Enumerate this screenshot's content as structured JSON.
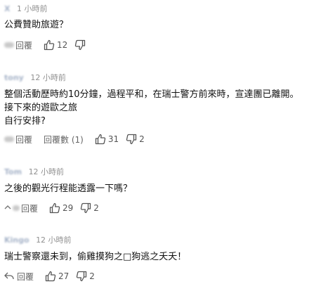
{
  "comments": [
    {
      "author": "X",
      "time": "1 小時前",
      "lines": [
        "公費贊助旅遊？"
      ],
      "reply_label": "回覆",
      "view_replies": "",
      "likes": "12",
      "dislikes": ""
    },
    {
      "author": "tony",
      "time": "12 小時前",
      "lines": [
        "整個活動歷時約10分鐘，過程平和，在瑞士警方前來時，宣達團已離開。",
        "接下來的遊歐之旅",
        "自行安排?"
      ],
      "reply_label": "回覆",
      "view_replies": "回覆數 (1)",
      "likes": "31",
      "dislikes": "2"
    },
    {
      "author": "Tom",
      "time": "12 小時前",
      "lines": [
        "之後的觀光行程能透露一下嗎？"
      ],
      "reply_label": "回覆",
      "view_replies": "",
      "likes": "29",
      "dislikes": "2"
    },
    {
      "author": "Kingo",
      "time": "12 小時前",
      "lines": [
        "瑞士警察還未到，偷雞摸狗之□狗逃之夭夭！"
      ],
      "reply_label": "回覆",
      "view_replies": "",
      "likes": "27",
      "dislikes": "2"
    }
  ]
}
